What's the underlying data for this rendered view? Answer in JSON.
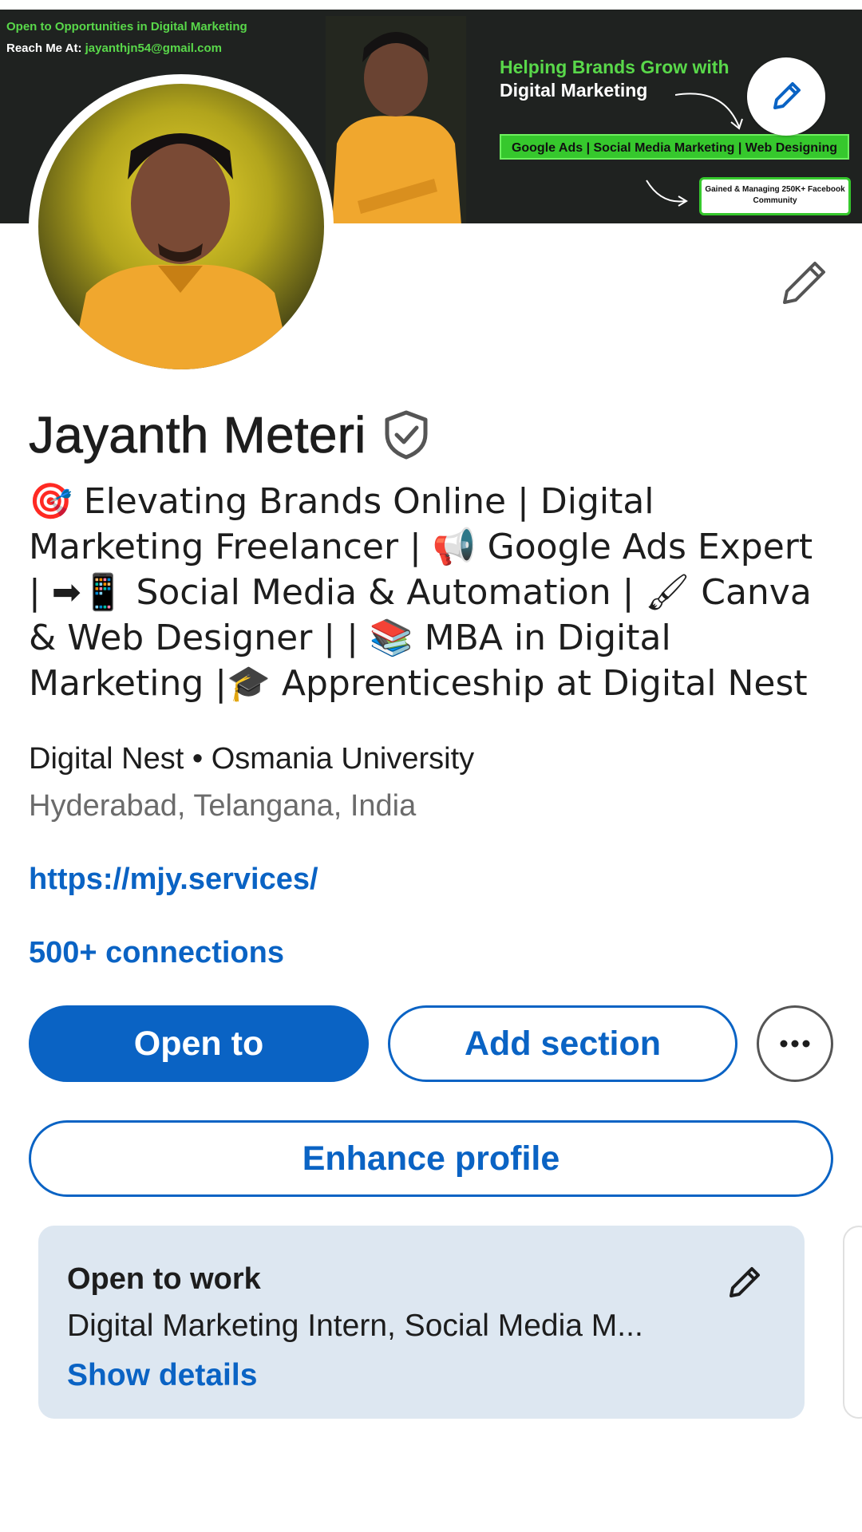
{
  "banner": {
    "line1": "Open to Opportunities in Digital Marketing",
    "line2_label": "Reach Me At:",
    "line2_email": "jayanthjn54@gmail.com",
    "headline_green": "Helping Brands Grow with",
    "headline_white": "Digital Marketing",
    "services": "Google Ads | Social Media Marketing | Web Designing",
    "badge": "Gained & Managing 250K+ Facebook Community"
  },
  "profile": {
    "name": "Jayanth Meteri",
    "headline": "🎯 Elevating Brands Online | Digital Marketing Freelancer | 📢 Google Ads Expert | ➡📱 Social Media & Automation | 🖌 Canva & Web Designer | | 📚 MBA in Digital Marketing |🎓 Apprenticeship at Digital Nest",
    "company": "Digital Nest • Osmania University",
    "location": "Hyderabad, Telangana, India",
    "website": "https://mjy.services/",
    "connections": "500+ connections"
  },
  "actions": {
    "open_to": "Open to",
    "add_section": "Add section",
    "more": "•••",
    "enhance": "Enhance profile"
  },
  "open_to_work": {
    "title": "Open to work",
    "description": "Digital Marketing Intern, Social Media M...",
    "link": "Show details"
  },
  "colors": {
    "accent": "#0a63c4",
    "banner_green": "#36c82d",
    "card_bg": "#dde7f1"
  }
}
